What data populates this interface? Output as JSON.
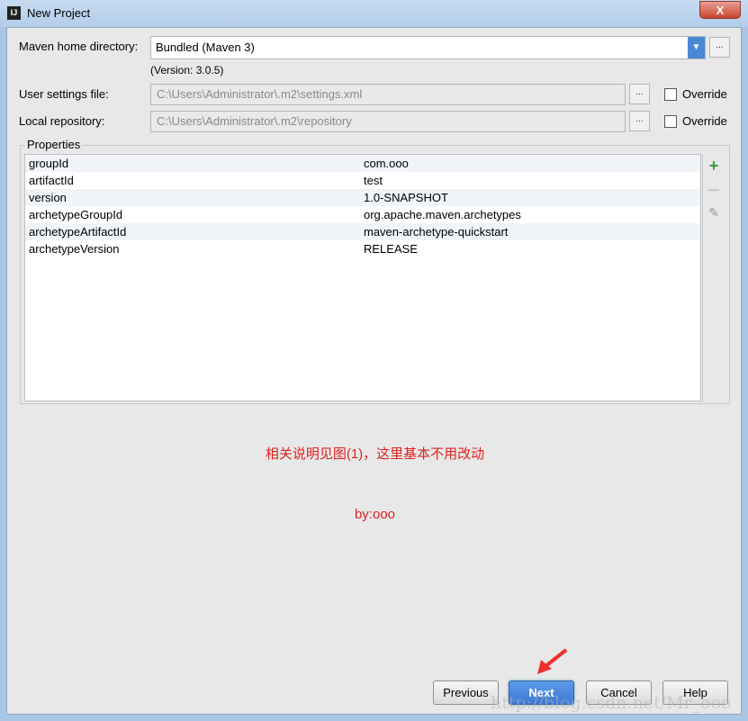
{
  "window": {
    "title": "New Project",
    "icon_text": "IJ",
    "close": "X"
  },
  "maven": {
    "home_label": "Maven home directory:",
    "home_value": "Bundled (Maven 3)",
    "version": "(Version: 3.0.5)",
    "settings_label": "User settings file:",
    "settings_value": "C:\\Users\\Administrator\\.m2\\settings.xml",
    "repo_label": "Local repository:",
    "repo_value": "C:\\Users\\Administrator\\.m2\\repository",
    "override": "Override",
    "browse": "..."
  },
  "properties": {
    "title": "Properties",
    "rows": [
      {
        "key": "groupId",
        "value": "com.ooo"
      },
      {
        "key": "artifactId",
        "value": "test"
      },
      {
        "key": "version",
        "value": "1.0-SNAPSHOT"
      },
      {
        "key": "archetypeGroupId",
        "value": "org.apache.maven.archetypes"
      },
      {
        "key": "archetypeArtifactId",
        "value": "maven-archetype-quickstart"
      },
      {
        "key": "archetypeVersion",
        "value": "RELEASE"
      }
    ],
    "add": "+",
    "remove": "—",
    "edit": "✎"
  },
  "notes": {
    "line1": "相关说明见图(1)，这里基本不用改动",
    "line2": "by:ooo"
  },
  "buttons": {
    "previous": "Previous",
    "next": "Next",
    "cancel": "Cancel",
    "help": "Help"
  },
  "watermark": "http://blog.csdn.net/Mr_ooo"
}
